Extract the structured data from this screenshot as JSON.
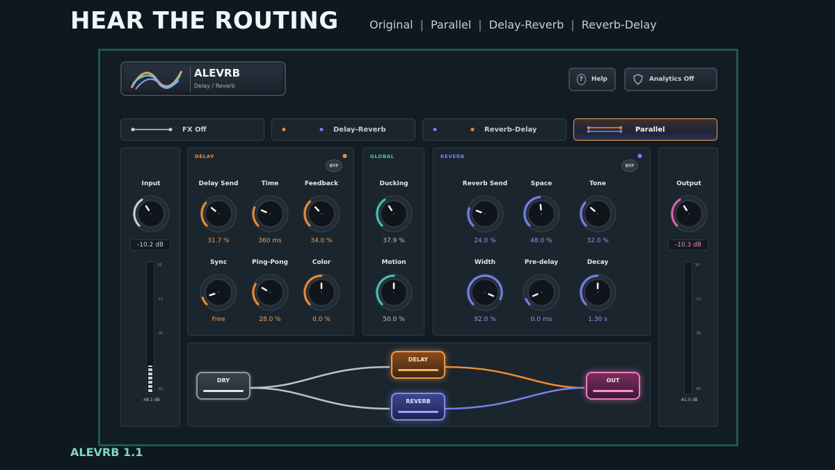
{
  "headline": "HEAR THE ROUTING",
  "routing_nav": [
    "Original",
    "Parallel",
    "Delay-Reverb",
    "Reverb-Delay"
  ],
  "routing_nav_separator": "|",
  "version_label": "ALEVRB 1.1",
  "app": {
    "name": "ALEVRB",
    "subtitle": "Delay / Reverb"
  },
  "top_buttons": {
    "help": "Help",
    "help_icon_glyph": "?",
    "analytics": "Analytics Off"
  },
  "routes": [
    {
      "label": "FX Off",
      "active": false
    },
    {
      "label": "Delay-Reverb",
      "active": false
    },
    {
      "label": "Reverb-Delay",
      "active": false
    },
    {
      "label": "Parallel",
      "active": true
    }
  ],
  "colors": {
    "delay": "#f08a30",
    "global": "#3fc7b4",
    "reverb": "#7480ee",
    "input": "#c9d2d9",
    "output": "#e85fb0",
    "active_route_border": "#f0a35a"
  },
  "input": {
    "label": "Input",
    "value": "-10.2 dB",
    "knob": 0.38,
    "meter_readout": "-48.1 dB",
    "meter_level": 0.2
  },
  "output": {
    "label": "Output",
    "value": "-10.3 dB",
    "knob": 0.38,
    "meter_readout": "-61.0 dB",
    "meter_level": 0.0
  },
  "meter_scale": [
    "16",
    "-12",
    "-36",
    "-60"
  ],
  "delay": {
    "title": "DELAY",
    "bypass": "BYP",
    "indicator": "●",
    "knobs": [
      {
        "label": "Delay Send",
        "value": "31.7 %",
        "pos": 0.317
      },
      {
        "label": "Time",
        "value": "360 ms",
        "pos": 0.25
      },
      {
        "label": "Feedback",
        "value": "34.0 %",
        "pos": 0.34
      },
      {
        "label": "Sync",
        "value": "Free",
        "pos": 0.1
      },
      {
        "label": "Ping-Pong",
        "value": "28.0 %",
        "pos": 0.28
      },
      {
        "label": "Color",
        "value": "0.0 %",
        "pos": 0.5
      }
    ]
  },
  "global": {
    "title": "GLOBAL",
    "knobs": [
      {
        "label": "Ducking",
        "value": "37.9 %",
        "pos": 0.379
      },
      {
        "label": "Motion",
        "value": "50.0 %",
        "pos": 0.5
      }
    ]
  },
  "reverb": {
    "title": "REVERB",
    "bypass": "BYP",
    "indicator": "●",
    "knobs": [
      {
        "label": "Reverb Send",
        "value": "24.0 %",
        "pos": 0.24
      },
      {
        "label": "Space",
        "value": "48.0 %",
        "pos": 0.48
      },
      {
        "label": "Tone",
        "value": "32.0 %",
        "pos": 0.32
      },
      {
        "label": "Width",
        "value": "92.0 %",
        "pos": 0.92
      },
      {
        "label": "Pre-delay",
        "value": "0.0 ms",
        "pos": 0.08
      },
      {
        "label": "Decay",
        "value": "1.30 s",
        "pos": 0.5
      }
    ]
  },
  "routing_nodes": {
    "dry": "DRY",
    "delay": "DELAY",
    "reverb": "REVERB",
    "out": "OUT"
  }
}
